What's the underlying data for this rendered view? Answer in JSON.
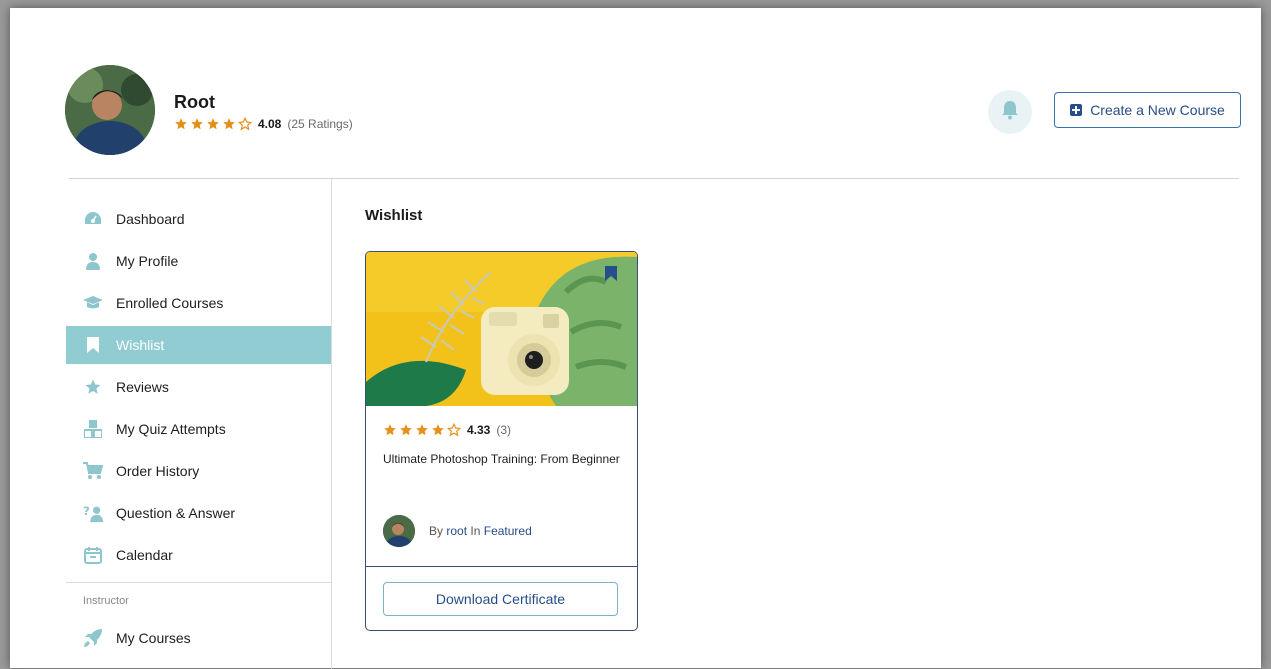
{
  "user": {
    "name": "Root",
    "rating_value": "4.08",
    "rating_count": "(25 Ratings)",
    "stars": 4
  },
  "header": {
    "create_course_label": "Create a New Course"
  },
  "sidebar": {
    "items": [
      {
        "label": "Dashboard",
        "icon": "dashboard-icon"
      },
      {
        "label": "My Profile",
        "icon": "user-icon"
      },
      {
        "label": "Enrolled Courses",
        "icon": "graduation-cap-icon"
      },
      {
        "label": "Wishlist",
        "icon": "bookmark-icon",
        "active": true
      },
      {
        "label": "Reviews",
        "icon": "star-icon"
      },
      {
        "label": "My Quiz Attempts",
        "icon": "quiz-icon"
      },
      {
        "label": "Order History",
        "icon": "cart-icon"
      },
      {
        "label": "Question & Answer",
        "icon": "question-icon"
      },
      {
        "label": "Calendar",
        "icon": "calendar-icon"
      }
    ],
    "section_label": "Instructor",
    "instructor_items": [
      {
        "label": "My Courses",
        "icon": "rocket-icon"
      }
    ]
  },
  "main": {
    "title": "Wishlist",
    "card": {
      "rating_value": "4.33",
      "rating_count": "(3)",
      "stars": 4,
      "title": "Ultimate Photoshop Training: From Beginner",
      "author_prefix": "By",
      "author": "root",
      "in_text": "In",
      "category": "Featured",
      "certificate_label": "Download Certificate"
    }
  },
  "colors": {
    "accent": "#92ccd3",
    "brand": "#264e8a",
    "star": "#e88f1a",
    "icon": "#8ec6cd"
  }
}
